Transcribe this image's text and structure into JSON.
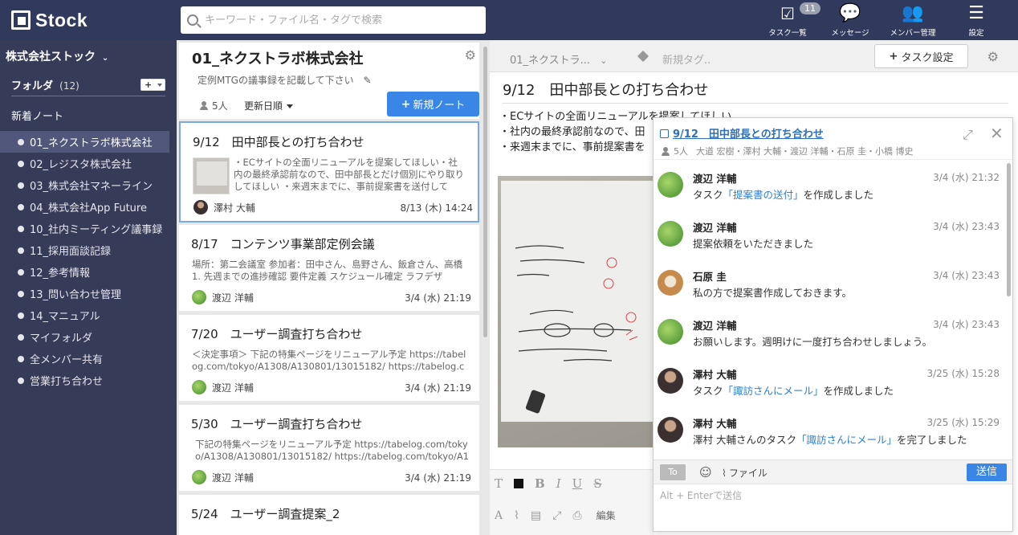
{
  "app": {
    "logo_text": "Stock"
  },
  "search": {
    "placeholder": "キーワード・ファイル名・タグで検索"
  },
  "top_nav": [
    {
      "label": "タスク一覧",
      "icon": "task-check-icon",
      "badge": "11"
    },
    {
      "label": "メッセージ",
      "icon": "chat-bubble-icon"
    },
    {
      "label": "メンバー管理",
      "icon": "members-icon"
    },
    {
      "label": "設定",
      "icon": "hamburger-menu-icon"
    }
  ],
  "sidebar": {
    "company": "株式会社ストック",
    "folder_title": "フォルダ",
    "folder_count": "(12)",
    "add_label": "+",
    "new_notes": "新着ノート",
    "folders": [
      "01_ネクストラボ株式会社",
      "02_レジスタ株式会社",
      "03_株式会社マネーライン",
      "04_株式会社App Future",
      "10_社内ミーティング議事録",
      "11_採用面談記録",
      "12_参考情報",
      "13_問い合わせ管理",
      "14_マニュアル",
      "マイフォルダ",
      "全メンバー共有",
      "営業打ち合わせ"
    ]
  },
  "folder_panel": {
    "title": "01_ネクストラボ株式会社",
    "description": "定例MTGの議事録を記載して下さい",
    "members": "5人",
    "sort": "更新日順",
    "new_note": "新規ノート"
  },
  "notes": [
    {
      "title": "9/12　田中部長との打ち合わせ",
      "excerpt": "・ECサイトの全面リニューアルを提案してほしい・社内の最終承認前なので、田中部長とだけ個別にやり取りしてほしい ・来週末までに、事前提案書を送付して",
      "author": "澤村 大輔",
      "date": "8/13 (木) 14:24"
    },
    {
      "title": "8/17　コンテンツ事業部定例会議",
      "excerpt": "場所：第二会議室 参加者：田中さん、島野さん、飯倉さん、高橋 1. 先週までの進捗確認 要件定義 スケジュール確定 ラフデザ",
      "author": "渡辺 洋輔",
      "date": "3/4 (水) 21:19"
    },
    {
      "title": "7/20　ユーザー調査打ち合わせ",
      "excerpt": "＜決定事項＞ 下記の特集ページをリニューアル予定 https://tabelog.com/tokyo/A1308/A130801/13015182/ https://tabelog.com/",
      "author": "渡辺 洋輔",
      "date": "3/4 (水) 21:19"
    },
    {
      "title": "5/30　ユーザー調査打ち合わせ",
      "excerpt": "下記の特集ページをリニューアル予定 https://tabelog.com/tokyo/A1308/A130801/13015182/ https://tabelog.com/tokyo/A130",
      "author": "渡辺 洋輔",
      "date": "3/4 (水) 21:19"
    },
    {
      "title": "5/24　ユーザー調査提案_2",
      "excerpt": "",
      "author": "",
      "date": ""
    }
  ],
  "editor": {
    "folder": "01_ネクストラ...",
    "tag_placeholder": "新規タグ..",
    "task_settings": "タスク設定",
    "title": "9/12　田中部長との打ち合わせ",
    "lines": [
      "・ECサイトの全面リニューアルを提案してほしい",
      "・社内の最終承認前なので、田",
      "・来週末までに、事前提案書を"
    ],
    "toolbar_edit": "編集"
  },
  "chat": {
    "title": "9/12　田中部長との打ち合わせ",
    "members_count": "5人",
    "members": "大道 宏樹・澤村 大輔・渡辺 洋輔・石原 圭・小橋 博史",
    "messages": [
      {
        "name": "渡辺 洋輔",
        "time": "3/4 (水) 21:32",
        "pre": "タスク",
        "link": "「提案書の送付」",
        "post": "を作成しました",
        "avatar": "green"
      },
      {
        "name": "渡辺 洋輔",
        "time": "3/4 (水) 23:43",
        "pre": "提案依頼をいただきました",
        "link": "",
        "post": "",
        "avatar": "green"
      },
      {
        "name": "石原 圭",
        "time": "3/4 (水) 23:43",
        "pre": "私の方で提案書作成しておきます。",
        "link": "",
        "post": "",
        "avatar": "dog"
      },
      {
        "name": "渡辺 洋輔",
        "time": "3/4 (水) 23:43",
        "pre": "お願いします。週明けに一度打ち合わせしましょう。",
        "link": "",
        "post": "",
        "avatar": "green"
      },
      {
        "name": "澤村 大輔",
        "time": "3/25 (水) 15:28",
        "pre": "タスク",
        "link": "「諏訪さんにメール」",
        "post": "を作成しました",
        "avatar": "person"
      },
      {
        "name": "澤村 大輔",
        "time": "3/25 (水) 15:29",
        "pre": "澤村 大輔さんのタスク",
        "link": "「諏訪さんにメール」",
        "post": "を完了しました",
        "avatar": "person"
      }
    ],
    "to_label": "To",
    "file_label": "ファイル",
    "send_label": "送信",
    "input_placeholder": "Alt + Enterで送信"
  }
}
